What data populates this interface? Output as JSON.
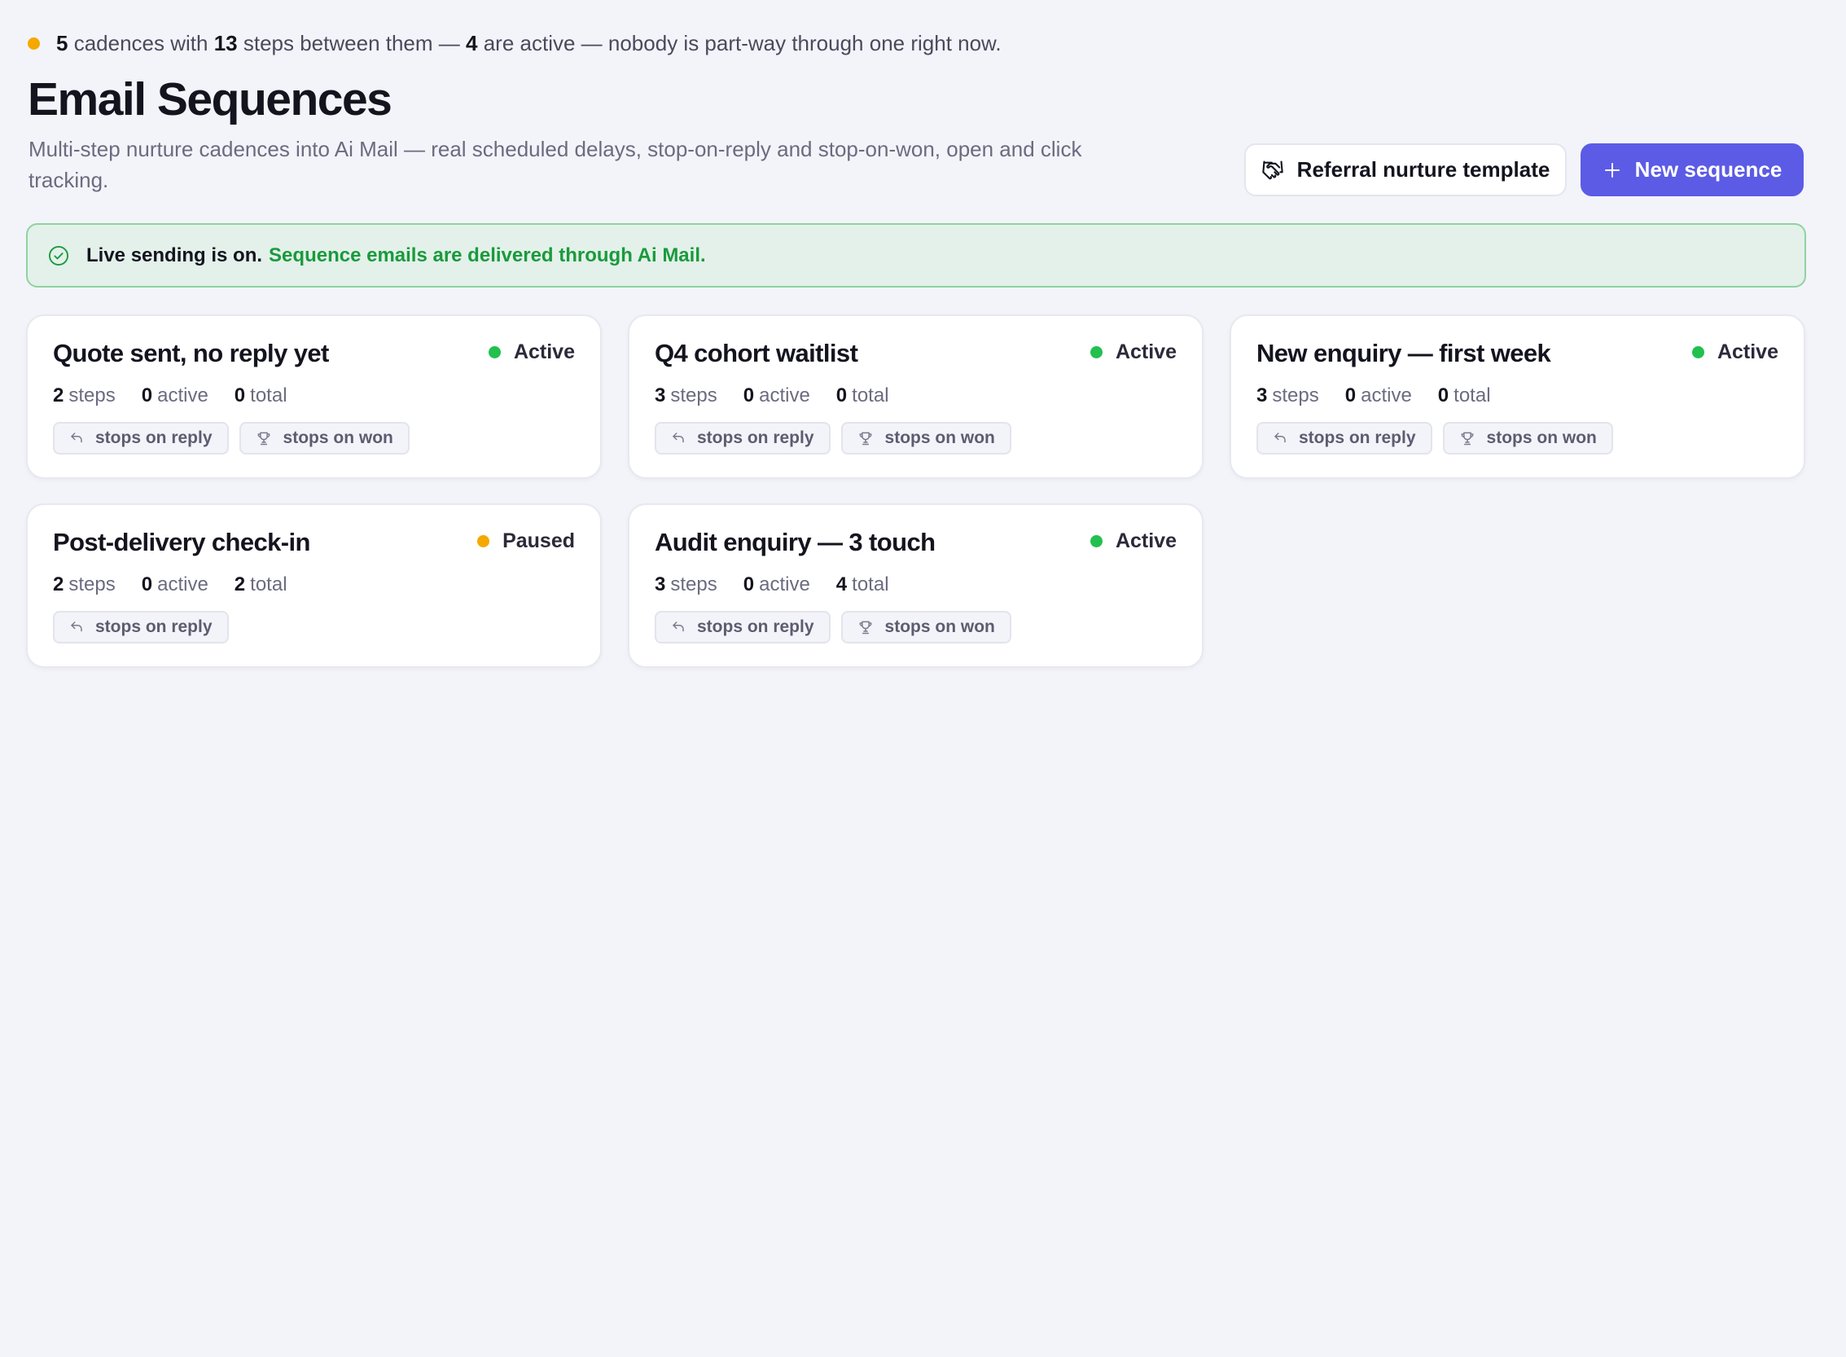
{
  "summary": {
    "dot_color": "#f5a800",
    "cadence_count": "5",
    "text_cadences": "cadences with",
    "step_count": "13",
    "text_steps": "steps between them —",
    "active_count": "4",
    "text_active": "are active — nobody is part-way through one right now."
  },
  "header": {
    "title": "Email Sequences",
    "subtitle": "Multi-step nurture cadences into Ai Mail — real scheduled delays, stop-on-reply and stop-on-won, open and click tracking."
  },
  "actions": {
    "template_label": "Referral nurture template",
    "template_icon": "handshake-icon",
    "new_label": "New sequence",
    "new_icon": "plus-icon",
    "accent_color": "#5b5be6"
  },
  "banner": {
    "icon": "check-circle-icon",
    "strong": "Live sending is on.",
    "message": "Sequence emails are delivered through Ai Mail."
  },
  "labels": {
    "steps": "steps",
    "active": "active",
    "total": "total",
    "stops_on_reply": "stops on reply",
    "stops_on_won": "stops on won"
  },
  "status_colors": {
    "Active": "#22c04f",
    "Paused": "#f5a800"
  },
  "sequences": [
    {
      "title": "Quote sent, no reply yet",
      "status": "Active",
      "steps": "2",
      "active": "0",
      "total": "0",
      "stops_on_reply": true,
      "stops_on_won": true
    },
    {
      "title": "Q4 cohort waitlist",
      "status": "Active",
      "steps": "3",
      "active": "0",
      "total": "0",
      "stops_on_reply": true,
      "stops_on_won": true
    },
    {
      "title": "New enquiry — first week",
      "status": "Active",
      "steps": "3",
      "active": "0",
      "total": "0",
      "stops_on_reply": true,
      "stops_on_won": true
    },
    {
      "title": "Post-delivery check-in",
      "status": "Paused",
      "steps": "2",
      "active": "0",
      "total": "2",
      "stops_on_reply": true,
      "stops_on_won": false
    },
    {
      "title": "Audit enquiry — 3 touch",
      "status": "Active",
      "steps": "3",
      "active": "0",
      "total": "4",
      "stops_on_reply": true,
      "stops_on_won": true
    }
  ]
}
